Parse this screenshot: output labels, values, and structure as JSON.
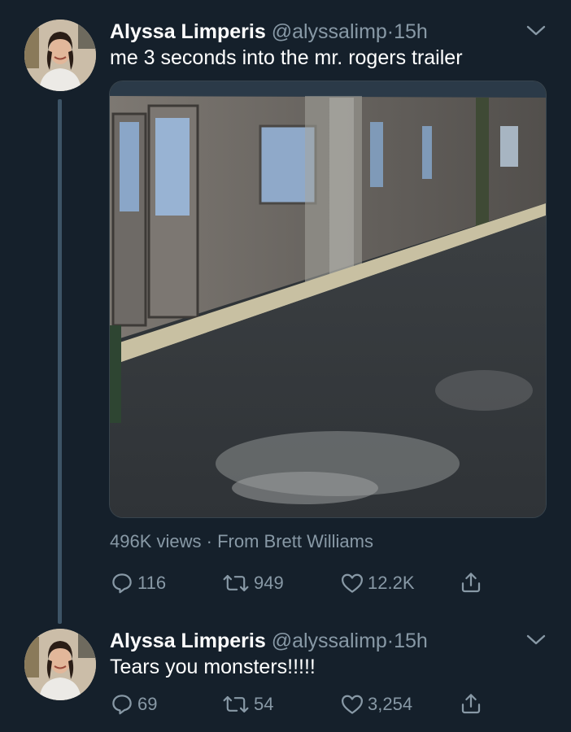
{
  "tweets": [
    {
      "display_name": "Alyssa Limperis",
      "handle": "@alyssalimp",
      "separator": "·",
      "time": "15h",
      "text": "me 3 seconds into the mr. rogers trailer",
      "media": {
        "type": "video",
        "views": "496K views",
        "meta_separator": "·",
        "source": "From Brett Williams"
      },
      "actions": {
        "reply_count": "116",
        "retweet_count": "949",
        "like_count": "12.2K"
      }
    },
    {
      "display_name": "Alyssa Limperis",
      "handle": "@alyssalimp",
      "separator": "·",
      "time": "15h",
      "text": "Tears you monsters!!!!!",
      "actions": {
        "reply_count": "69",
        "retweet_count": "54",
        "like_count": "3,254"
      }
    }
  ],
  "icons": {
    "reply": "reply-icon",
    "retweet": "retweet-icon",
    "like": "heart-icon",
    "share": "share-icon",
    "caret": "chevron-down-icon"
  },
  "colors": {
    "background": "#15202b",
    "secondary_text": "#8899a6",
    "thread_line": "#3d5466"
  }
}
